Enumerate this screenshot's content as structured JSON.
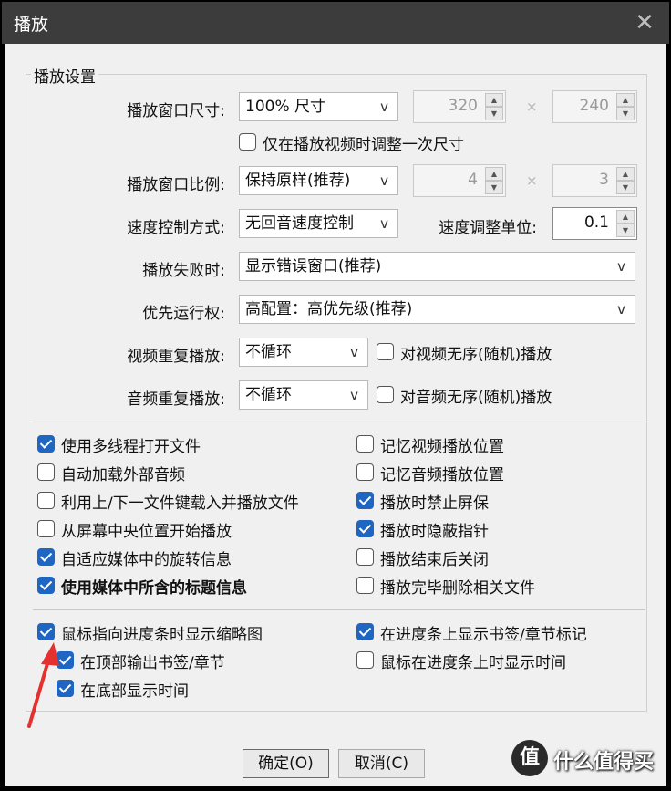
{
  "window": {
    "title": "播放",
    "close_glyph": "✕"
  },
  "group_title": "播放设置",
  "window_size": {
    "label": "播放窗口尺寸:",
    "select": "100% 尺寸",
    "width": "320",
    "height": "240",
    "times": "×",
    "resize_once": {
      "label": "仅在播放视频时调整一次尺寸",
      "checked": false
    }
  },
  "aspect": {
    "label": "播放窗口比例:",
    "select": "保持原样(推荐)",
    "w": "4",
    "h": "3",
    "times": "×"
  },
  "speed": {
    "label": "速度控制方式:",
    "select": "无回音速度控制",
    "unit_label": "速度调整单位:",
    "unit_value": "0.1"
  },
  "fail": {
    "label": "播放失败时:",
    "select": "显示错误窗口(推荐)"
  },
  "priority": {
    "label": "优先运行权:",
    "select": "高配置：高优先级(推荐)"
  },
  "video_repeat": {
    "label": "视频重复播放:",
    "select": "不循环",
    "shuffle": {
      "label": "对视频无序(随机)播放",
      "checked": false
    }
  },
  "audio_repeat": {
    "label": "音频重复播放:",
    "select": "不循环",
    "shuffle": {
      "label": "对音频无序(随机)播放",
      "checked": false
    }
  },
  "dropdown_glyph": "v",
  "options_left": [
    {
      "label": "使用多线程打开文件",
      "checked": true,
      "bold": false
    },
    {
      "label": "自动加载外部音频",
      "checked": false,
      "bold": false
    },
    {
      "label": "利用上/下一文件键载入并播放文件",
      "checked": false,
      "bold": false
    },
    {
      "label": "从屏幕中央位置开始播放",
      "checked": false,
      "bold": false
    },
    {
      "label": "自适应媒体中的旋转信息",
      "checked": true,
      "bold": false
    },
    {
      "label": "使用媒体中所含的标题信息",
      "checked": true,
      "bold": true
    }
  ],
  "options_right": [
    {
      "label": "记忆视频播放位置",
      "checked": false
    },
    {
      "label": "记忆音频播放位置",
      "checked": false
    },
    {
      "label": "播放时禁止屏保",
      "checked": true
    },
    {
      "label": "播放时隐蔽指针",
      "checked": true
    },
    {
      "label": "播放结束后关闭",
      "checked": false
    },
    {
      "label": "播放完毕删除相关文件",
      "checked": false
    }
  ],
  "seekbar": {
    "thumbnail": {
      "label": "鼠标指向进度条时显示缩略图",
      "checked": true
    },
    "top_chapters": {
      "label": "在顶部输出书签/章节",
      "checked": true
    },
    "bottom_time": {
      "label": "在底部显示时间",
      "checked": true
    },
    "show_bookmarks": {
      "label": "在进度条上显示书签/章节标记",
      "checked": true
    },
    "hover_time": {
      "label": "鼠标在进度条上时显示时间",
      "checked": false
    }
  },
  "buttons": {
    "ok": "确定(O)",
    "cancel": "取消(C)"
  },
  "watermark": {
    "badge": "值",
    "text": "什么值得买"
  },
  "colors": {
    "check_blue": "#1f66c2",
    "annotation_red": "#e4302f"
  }
}
